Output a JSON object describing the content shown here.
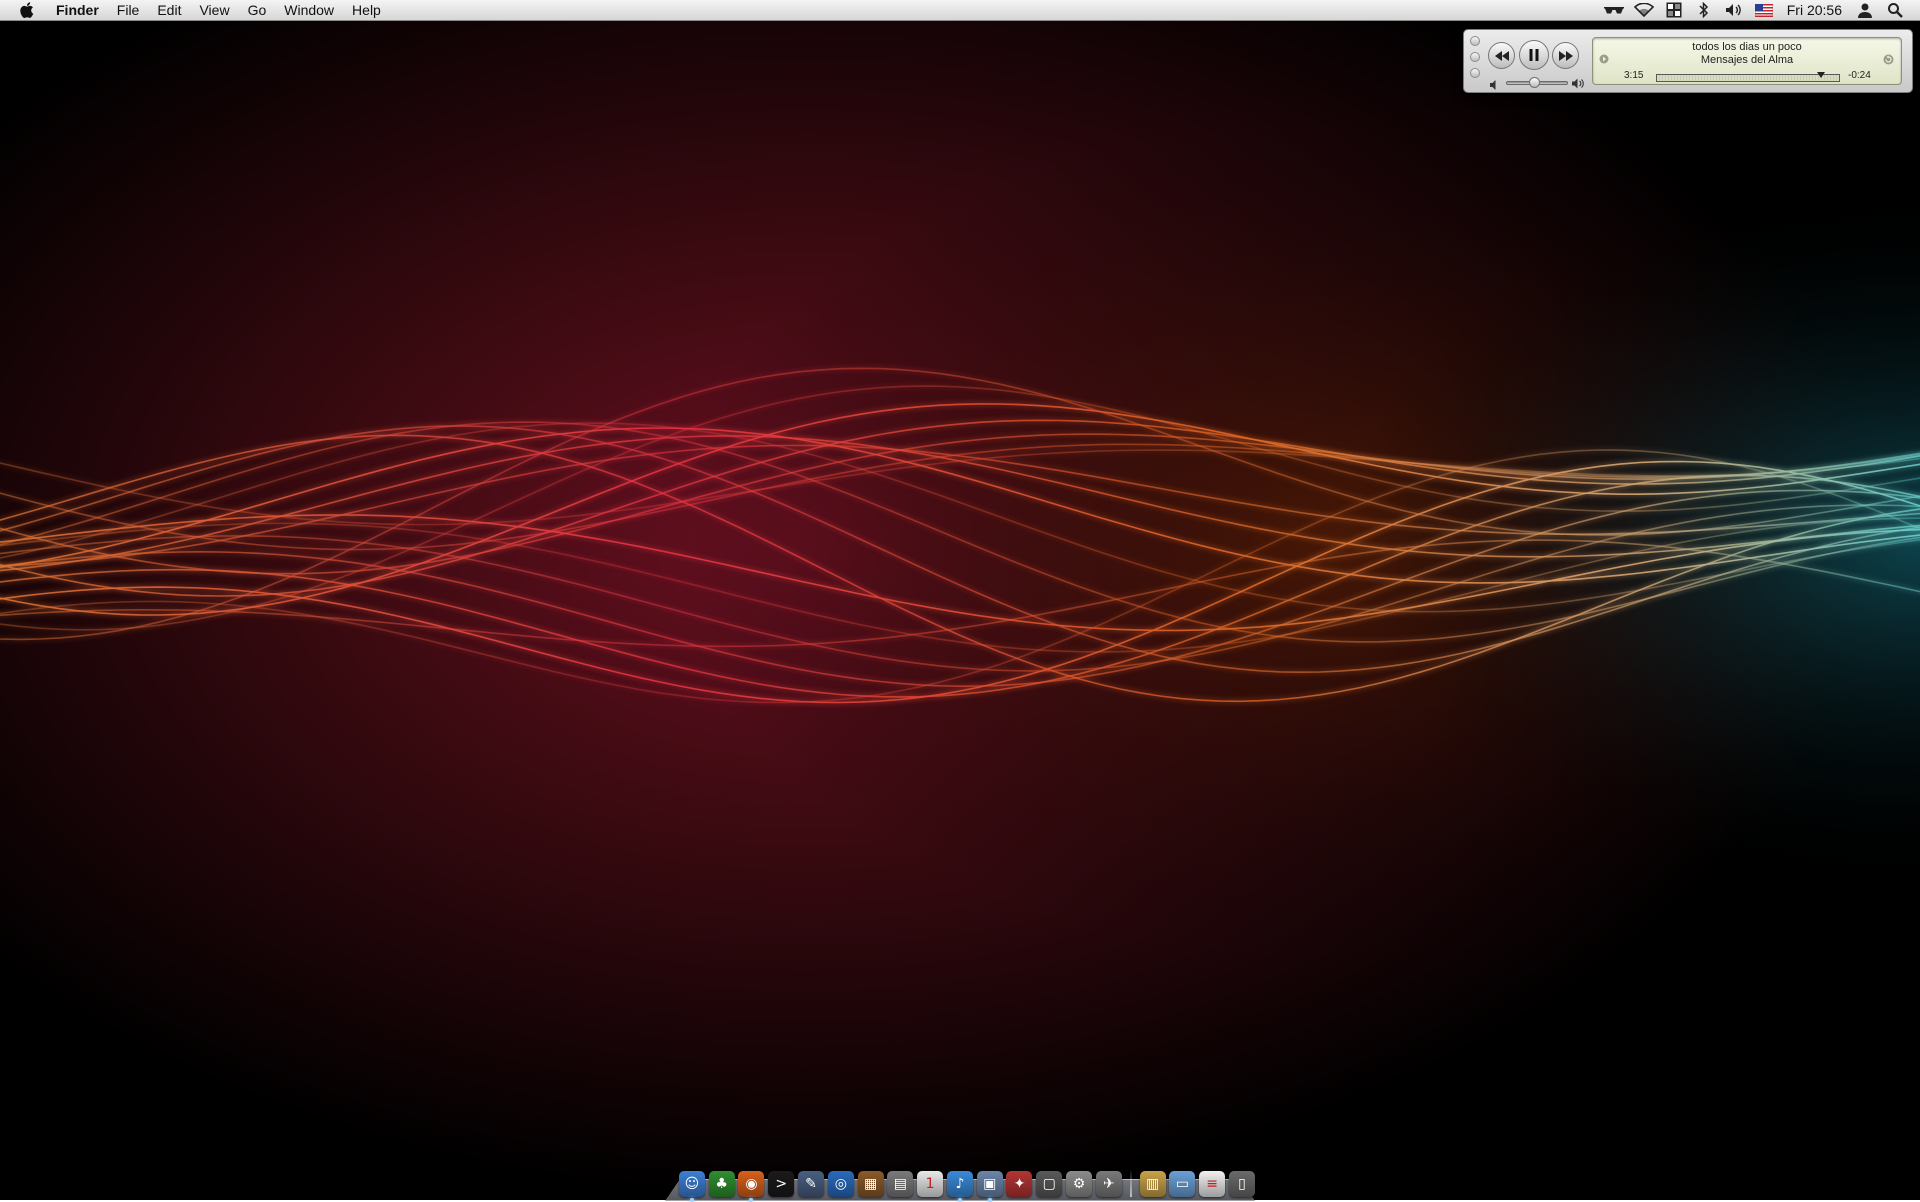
{
  "menubar": {
    "app_name": "Finder",
    "items": [
      "File",
      "Edit",
      "View",
      "Go",
      "Window",
      "Help"
    ],
    "clock": "Fri 20:56",
    "status_icons": [
      "sunglasses-icon",
      "wifi-icon",
      "spaces-icon",
      "bluetooth-icon",
      "volume-icon",
      "us-flag-icon"
    ]
  },
  "miniplayer": {
    "song_title": "todos los dias un poco",
    "artist": "Mensajes del Alma",
    "elapsed": "3:15",
    "remaining": "-0:24",
    "progress_fraction": 0.89,
    "volume_fraction": 0.45
  },
  "dock": {
    "items": [
      {
        "name": "finder",
        "color": "#3d7fd6",
        "glyph": "☺"
      },
      {
        "name": "adium",
        "color": "#2f8f2f",
        "glyph": "♣"
      },
      {
        "name": "firefox",
        "color": "#d8601c",
        "glyph": "◉"
      },
      {
        "name": "terminal",
        "color": "#1a1a1a",
        "glyph": ">"
      },
      {
        "name": "xcode",
        "color": "#4a5f80",
        "glyph": "✎"
      },
      {
        "name": "cyberduck",
        "color": "#2a6bbd",
        "glyph": "◎"
      },
      {
        "name": "photo-app",
        "color": "#8a5a2a",
        "glyph": "▦"
      },
      {
        "name": "archive-utility",
        "color": "#7a7a7a",
        "glyph": "▤"
      },
      {
        "name": "ical",
        "color": "#e9e9e9",
        "glyph": "1"
      },
      {
        "name": "itunes",
        "color": "#3a8ad8",
        "glyph": "♪"
      },
      {
        "name": "preview",
        "color": "#6b86a8",
        "glyph": "▣"
      },
      {
        "name": "system-app",
        "color": "#b43535",
        "glyph": "✦"
      },
      {
        "name": "photo-booth",
        "color": "#5a5a5a",
        "glyph": "▢"
      },
      {
        "name": "system-preferences",
        "color": "#8c8c8c",
        "glyph": "⚙"
      },
      {
        "name": "automator",
        "color": "#7a7a7a",
        "glyph": "✈"
      }
    ],
    "right_items": [
      {
        "name": "downloads-stack",
        "color": "#c9a24a",
        "glyph": "▥"
      },
      {
        "name": "documents-folder",
        "color": "#6aa0d8",
        "glyph": "▭"
      },
      {
        "name": "text-document",
        "color": "#f0f0f0",
        "glyph": "≡"
      },
      {
        "name": "trash",
        "color": "#6a6a6a",
        "glyph": "▯"
      }
    ]
  }
}
